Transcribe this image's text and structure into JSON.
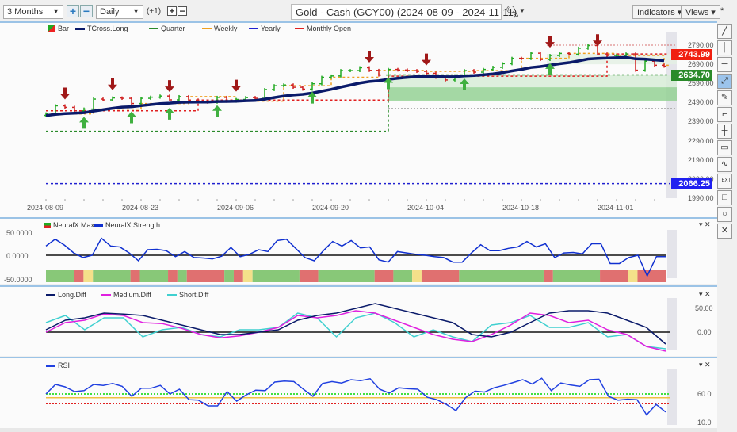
{
  "toolbar": {
    "range": "3 Months",
    "interval": "Daily",
    "offset": "(+1)",
    "title": "Gold - Cash (GCY00) (2024-08-09 - 2024-11-11)",
    "indicators": "Indicators",
    "views": "Views",
    "star": "*",
    "zoom_in": "+",
    "zoom_out": "−",
    "plus": "+",
    "minus": "−"
  },
  "legend": [
    {
      "label": "Bar",
      "color": "#22aa22"
    },
    {
      "label": "TCross.Long",
      "color": "#0a1a6a"
    },
    {
      "label": "Quarter",
      "color": "#2a8a2a"
    },
    {
      "label": "Weekly",
      "color": "#f0a020"
    },
    {
      "label": "Yearly",
      "color": "#2020d0"
    },
    {
      "label": "Monthly Open",
      "color": "#e02020"
    }
  ],
  "price_axis": [
    "2790.00",
    "2690.00",
    "2590.00",
    "2490.00",
    "2390.00",
    "2290.00",
    "2190.00",
    "2090.00",
    "1990.00"
  ],
  "price_labels": {
    "monthly_open": "2743.99",
    "quarter": "2634.70",
    "yearly": "2066.25"
  },
  "date_axis": [
    "2024-08-09",
    "2024-08-23",
    "2024-09-06",
    "2024-09-20",
    "2024-10-04",
    "2024-10-18",
    "2024-11-01"
  ],
  "tools": [
    "line",
    "vertical-line",
    "horizontal-line",
    "ray",
    "highlighter",
    "step",
    "crosshair",
    "callout",
    "wave",
    "TEXT",
    "rectangle",
    "ellipse",
    "close"
  ],
  "chart_data": [
    {
      "type": "ohlc",
      "title": "Gold - Cash (GCY00)",
      "ylim": [
        1990,
        2790
      ],
      "close": [
        2431,
        2473,
        2465,
        2447,
        2456,
        2508,
        2504,
        2514,
        2512,
        2485,
        2512,
        2518,
        2524,
        2504,
        2521,
        2503,
        2494,
        2492,
        2517,
        2497,
        2506,
        2516,
        2512,
        2558,
        2578,
        2582,
        2570,
        2560,
        2588,
        2622,
        2629,
        2657,
        2657,
        2672,
        2658,
        2634,
        2663,
        2660,
        2657,
        2653,
        2643,
        2622,
        2608,
        2630,
        2657,
        2649,
        2663,
        2674,
        2693,
        2721,
        2720,
        2748,
        2715,
        2736,
        2747,
        2743,
        2774,
        2788,
        2744,
        2736,
        2736,
        2744,
        2659,
        2706,
        2685,
        2680
      ],
      "quarter_open": [
        {
          "from": 0,
          "value": 2340
        },
        {
          "from": 36,
          "value": 2634.7
        }
      ],
      "monthly_open": [
        {
          "from": 0,
          "value": 2447
        },
        {
          "from": 16,
          "value": 2503
        },
        {
          "from": 36,
          "value": 2628
        },
        {
          "from": 59,
          "value": 2743.99
        }
      ],
      "yearly_open": 2066.25,
      "sell_signals": [
        2,
        7,
        13,
        20,
        34,
        40,
        53,
        58
      ],
      "buy_signals": [
        4,
        9,
        13,
        18,
        28,
        36,
        44,
        53
      ]
    },
    {
      "type": "line",
      "title": "NeuralX",
      "ylim": [
        -50,
        50
      ],
      "ticks": [
        "50.0000",
        "0.0000",
        "-50.0000"
      ],
      "legend": [
        "NeuralX.Max",
        "NeuralX.Strength"
      ],
      "strength": [
        20,
        35,
        22,
        5,
        -5,
        0,
        37,
        20,
        18,
        5,
        -12,
        12,
        13,
        10,
        -3,
        8,
        -5,
        -6,
        -8,
        -2,
        17,
        -3,
        2,
        12,
        8,
        32,
        35,
        15,
        -5,
        -12,
        10,
        30,
        20,
        32,
        16,
        18,
        -10,
        -15,
        8,
        5,
        2,
        0,
        -3,
        -5,
        -15,
        -15,
        5,
        23,
        10,
        10,
        15,
        18,
        30,
        18,
        25,
        -5,
        5,
        6,
        3,
        25,
        25,
        -18,
        -18,
        -5,
        0,
        -45,
        -3,
        -3
      ],
      "max_strip": [
        [
          "bull",
          3
        ],
        [
          "bear",
          1
        ],
        [
          "neutral",
          1
        ],
        [
          "bull",
          4
        ],
        [
          "bear",
          1
        ],
        [
          "bull",
          3
        ],
        [
          "bear",
          1
        ],
        [
          "bull",
          1
        ],
        [
          "bear",
          4
        ],
        [
          "bull",
          1
        ],
        [
          "bear",
          1
        ],
        [
          "neutral",
          1
        ],
        [
          "bull",
          5
        ],
        [
          "bear",
          2
        ],
        [
          "bull",
          6
        ],
        [
          "bear",
          2
        ],
        [
          "bull",
          2
        ],
        [
          "neutral",
          1
        ],
        [
          "bear",
          4
        ],
        [
          "bull",
          9
        ],
        [
          "bear",
          1
        ],
        [
          "bull",
          5
        ],
        [
          "bear",
          3
        ],
        [
          "neutral",
          1
        ],
        [
          "bear",
          3
        ]
      ]
    },
    {
      "type": "line",
      "title": "Diff",
      "ylim": [
        -40,
        65
      ],
      "ticks": [
        "50.00",
        "0.00"
      ],
      "series": [
        {
          "name": "Long.Diff",
          "color": "#0a1a6a",
          "values": [
            5,
            25,
            30,
            40,
            38,
            35,
            25,
            15,
            5,
            -5,
            -5,
            0,
            5,
            25,
            35,
            40,
            50,
            60,
            50,
            40,
            30,
            20,
            -5,
            -10,
            0,
            20,
            40,
            45,
            45,
            40,
            25,
            10,
            -25
          ]
        },
        {
          "name": "Medium.Diff",
          "color": "#e020e0",
          "values": [
            0,
            20,
            25,
            38,
            35,
            20,
            18,
            8,
            -5,
            -12,
            -8,
            0,
            10,
            35,
            30,
            35,
            45,
            40,
            25,
            10,
            -5,
            -15,
            -20,
            -5,
            15,
            40,
            35,
            20,
            25,
            5,
            -5,
            -30,
            -40
          ]
        },
        {
          "name": "Short.Diff",
          "color": "#40d0d0",
          "values": [
            20,
            35,
            5,
            30,
            30,
            -10,
            5,
            10,
            -5,
            -10,
            5,
            5,
            10,
            40,
            30,
            -10,
            30,
            40,
            20,
            -10,
            5,
            -10,
            -20,
            15,
            20,
            35,
            10,
            10,
            20,
            -10,
            -5,
            -30,
            -35
          ]
        }
      ]
    },
    {
      "type": "line",
      "title": "RSI",
      "ylim": [
        5,
        110
      ],
      "ticks": [
        "60.0",
        "10.0"
      ],
      "levels": {
        "upper": 60,
        "mid": 52,
        "lower": 40
      },
      "series": [
        {
          "name": "RSI",
          "color": "#2040e0",
          "values": [
            60,
            80,
            75,
            65,
            67,
            80,
            78,
            82,
            76,
            55,
            72,
            72,
            78,
            60,
            70,
            48,
            47,
            35,
            35,
            65,
            45,
            58,
            68,
            67,
            85,
            87,
            86,
            70,
            55,
            82,
            86,
            83,
            90,
            88,
            92,
            70,
            62,
            73,
            71,
            70,
            53,
            48,
            38,
            25,
            52,
            66,
            64,
            73,
            78,
            84,
            90,
            81,
            93,
            67,
            83,
            79,
            76,
            90,
            91,
            55,
            47,
            49,
            48,
            16,
            38,
            22
          ]
        }
      ]
    }
  ]
}
